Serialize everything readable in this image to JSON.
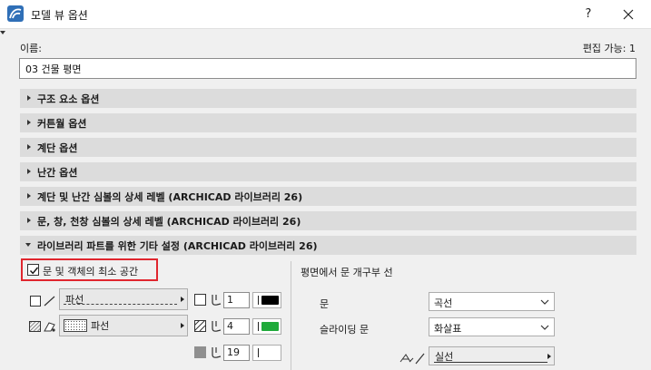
{
  "window": {
    "title": "모델 뷰 옵션",
    "help_label": "?",
    "app_icon": "archicad-icon"
  },
  "header": {
    "name_label": "이름:",
    "edit_count": "편집 가능: 1",
    "name_value": "03 건물 평면"
  },
  "sections": [
    {
      "label": "구조 요소 옵션",
      "expanded": false
    },
    {
      "label": "커튼월 옵션",
      "expanded": false
    },
    {
      "label": "계단 옵션",
      "expanded": false
    },
    {
      "label": "난간 옵션",
      "expanded": false
    },
    {
      "label": "계단 및 난간 심볼의 상세 레벨 (ARCHICAD 라이브러리 26)",
      "expanded": false
    },
    {
      "label": "문, 창, 천창 심볼의 상세 레벨 (ARCHICAD 라이브러리 26)",
      "expanded": false
    },
    {
      "label": "라이브러리 파트를 위한 기타 설정 (ARCHICAD 라이브러리 26)",
      "expanded": true
    }
  ],
  "library_settings": {
    "checkbox": {
      "label": "문 및 객체의 최소 공간",
      "checked": true
    },
    "line_type": {
      "label": "파선",
      "icon": "line-type-icon"
    },
    "fill_type": {
      "label": "파선",
      "icon": "fill-pattern-icon"
    },
    "pens": [
      {
        "value": "1",
        "color": "#000000",
        "icon": "line-pen-icon"
      },
      {
        "value": "4",
        "color": "#1faa3a",
        "icon": "hatch-pen-icon"
      },
      {
        "value": "19",
        "color": "#ffffff",
        "icon": "background-pen-icon"
      }
    ],
    "right_title": "평면에서 문 개구부 선",
    "door_label": "문",
    "door_value": "곡선",
    "sliding_label": "슬라이딩 문",
    "sliding_value": "화살표",
    "line_value": "실선"
  },
  "colors": {
    "highlight": "#e0262e",
    "section_bg": "#dcdcdc"
  }
}
